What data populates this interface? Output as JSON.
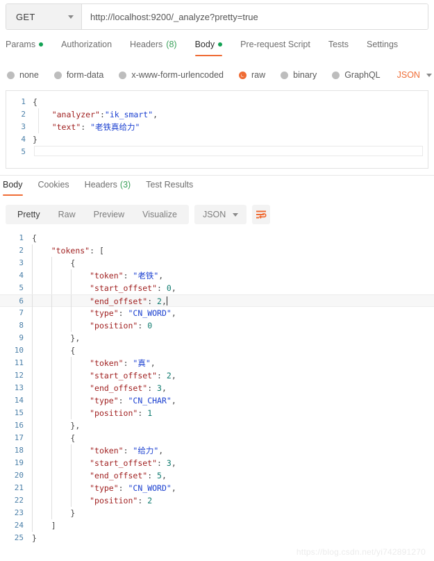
{
  "request_bar": {
    "method": "GET",
    "url": "http://localhost:9200/_analyze?pretty=true"
  },
  "request_tabs": [
    {
      "label": "Params",
      "indicator": "dot",
      "active": false
    },
    {
      "label": "Authorization",
      "indicator": "",
      "active": false
    },
    {
      "label": "Headers",
      "count": "(8)",
      "indicator": "count",
      "active": false
    },
    {
      "label": "Body",
      "indicator": "dot",
      "active": true
    },
    {
      "label": "Pre-request Script",
      "indicator": "",
      "active": false
    },
    {
      "label": "Tests",
      "indicator": "",
      "active": false
    },
    {
      "label": "Settings",
      "indicator": "",
      "active": false
    }
  ],
  "body_types": [
    {
      "label": "none",
      "selected": false
    },
    {
      "label": "form-data",
      "selected": false
    },
    {
      "label": "x-www-form-urlencoded",
      "selected": false
    },
    {
      "label": "raw",
      "selected": true
    },
    {
      "label": "binary",
      "selected": false
    },
    {
      "label": "GraphQL",
      "selected": false
    }
  ],
  "body_format": {
    "label": "JSON"
  },
  "request_body": {
    "lines": [
      {
        "num": "1",
        "segments": [
          {
            "t": "{",
            "c": "p"
          }
        ]
      },
      {
        "num": "2",
        "segments": [
          {
            "t": "    ",
            "c": "p"
          },
          {
            "t": "\"analyzer\"",
            "c": "k"
          },
          {
            "t": ":",
            "c": "p"
          },
          {
            "t": "\"ik_smart\"",
            "c": "s"
          },
          {
            "t": ",",
            "c": "p"
          }
        ]
      },
      {
        "num": "3",
        "segments": [
          {
            "t": "    ",
            "c": "p"
          },
          {
            "t": "\"text\"",
            "c": "k"
          },
          {
            "t": ": ",
            "c": "p"
          },
          {
            "t": "\"老铁真给力\"",
            "c": "s"
          }
        ]
      },
      {
        "num": "4",
        "segments": [
          {
            "t": "}",
            "c": "p"
          }
        ]
      },
      {
        "num": "5",
        "segments": []
      }
    ]
  },
  "response_tabs": [
    {
      "label": "Body",
      "active": true
    },
    {
      "label": "Cookies",
      "active": false
    },
    {
      "label": "Headers",
      "count": "(3)",
      "active": false
    },
    {
      "label": "Test Results",
      "active": false
    }
  ],
  "response_views": [
    {
      "label": "Pretty",
      "active": true
    },
    {
      "label": "Raw",
      "active": false
    },
    {
      "label": "Preview",
      "active": false
    },
    {
      "label": "Visualize",
      "active": false
    }
  ],
  "response_format": {
    "label": "JSON"
  },
  "response_body": {
    "active_line": 6,
    "lines": [
      {
        "num": "1",
        "indent": 0,
        "segments": [
          {
            "t": "{",
            "c": "p"
          }
        ]
      },
      {
        "num": "2",
        "indent": 1,
        "segments": [
          {
            "t": "    ",
            "c": "p"
          },
          {
            "t": "\"tokens\"",
            "c": "k"
          },
          {
            "t": ": [",
            "c": "p"
          }
        ]
      },
      {
        "num": "3",
        "indent": 2,
        "segments": [
          {
            "t": "        ",
            "c": "p"
          },
          {
            "t": "{",
            "c": "p"
          }
        ]
      },
      {
        "num": "4",
        "indent": 3,
        "segments": [
          {
            "t": "            ",
            "c": "p"
          },
          {
            "t": "\"token\"",
            "c": "k"
          },
          {
            "t": ": ",
            "c": "p"
          },
          {
            "t": "\"老铁\"",
            "c": "s"
          },
          {
            "t": ",",
            "c": "p"
          }
        ]
      },
      {
        "num": "5",
        "indent": 3,
        "segments": [
          {
            "t": "            ",
            "c": "p"
          },
          {
            "t": "\"start_offset\"",
            "c": "k"
          },
          {
            "t": ": ",
            "c": "p"
          },
          {
            "t": "0",
            "c": "n"
          },
          {
            "t": ",",
            "c": "p"
          }
        ]
      },
      {
        "num": "6",
        "indent": 3,
        "segments": [
          {
            "t": "            ",
            "c": "p"
          },
          {
            "t": "\"end_offset\"",
            "c": "k"
          },
          {
            "t": ": ",
            "c": "p"
          },
          {
            "t": "2",
            "c": "n"
          },
          {
            "t": ",",
            "c": "p"
          }
        ]
      },
      {
        "num": "7",
        "indent": 3,
        "segments": [
          {
            "t": "            ",
            "c": "p"
          },
          {
            "t": "\"type\"",
            "c": "k"
          },
          {
            "t": ": ",
            "c": "p"
          },
          {
            "t": "\"CN_WORD\"",
            "c": "s"
          },
          {
            "t": ",",
            "c": "p"
          }
        ]
      },
      {
        "num": "8",
        "indent": 3,
        "segments": [
          {
            "t": "            ",
            "c": "p"
          },
          {
            "t": "\"position\"",
            "c": "k"
          },
          {
            "t": ": ",
            "c": "p"
          },
          {
            "t": "0",
            "c": "n"
          }
        ]
      },
      {
        "num": "9",
        "indent": 2,
        "segments": [
          {
            "t": "        ",
            "c": "p"
          },
          {
            "t": "},",
            "c": "p"
          }
        ]
      },
      {
        "num": "10",
        "indent": 2,
        "segments": [
          {
            "t": "        ",
            "c": "p"
          },
          {
            "t": "{",
            "c": "p"
          }
        ]
      },
      {
        "num": "11",
        "indent": 3,
        "segments": [
          {
            "t": "            ",
            "c": "p"
          },
          {
            "t": "\"token\"",
            "c": "k"
          },
          {
            "t": ": ",
            "c": "p"
          },
          {
            "t": "\"真\"",
            "c": "s"
          },
          {
            "t": ",",
            "c": "p"
          }
        ]
      },
      {
        "num": "12",
        "indent": 3,
        "segments": [
          {
            "t": "            ",
            "c": "p"
          },
          {
            "t": "\"start_offset\"",
            "c": "k"
          },
          {
            "t": ": ",
            "c": "p"
          },
          {
            "t": "2",
            "c": "n"
          },
          {
            "t": ",",
            "c": "p"
          }
        ]
      },
      {
        "num": "13",
        "indent": 3,
        "segments": [
          {
            "t": "            ",
            "c": "p"
          },
          {
            "t": "\"end_offset\"",
            "c": "k"
          },
          {
            "t": ": ",
            "c": "p"
          },
          {
            "t": "3",
            "c": "n"
          },
          {
            "t": ",",
            "c": "p"
          }
        ]
      },
      {
        "num": "14",
        "indent": 3,
        "segments": [
          {
            "t": "            ",
            "c": "p"
          },
          {
            "t": "\"type\"",
            "c": "k"
          },
          {
            "t": ": ",
            "c": "p"
          },
          {
            "t": "\"CN_CHAR\"",
            "c": "s"
          },
          {
            "t": ",",
            "c": "p"
          }
        ]
      },
      {
        "num": "15",
        "indent": 3,
        "segments": [
          {
            "t": "            ",
            "c": "p"
          },
          {
            "t": "\"position\"",
            "c": "k"
          },
          {
            "t": ": ",
            "c": "p"
          },
          {
            "t": "1",
            "c": "n"
          }
        ]
      },
      {
        "num": "16",
        "indent": 2,
        "segments": [
          {
            "t": "        ",
            "c": "p"
          },
          {
            "t": "},",
            "c": "p"
          }
        ]
      },
      {
        "num": "17",
        "indent": 2,
        "segments": [
          {
            "t": "        ",
            "c": "p"
          },
          {
            "t": "{",
            "c": "p"
          }
        ]
      },
      {
        "num": "18",
        "indent": 3,
        "segments": [
          {
            "t": "            ",
            "c": "p"
          },
          {
            "t": "\"token\"",
            "c": "k"
          },
          {
            "t": ": ",
            "c": "p"
          },
          {
            "t": "\"给力\"",
            "c": "s"
          },
          {
            "t": ",",
            "c": "p"
          }
        ]
      },
      {
        "num": "19",
        "indent": 3,
        "segments": [
          {
            "t": "            ",
            "c": "p"
          },
          {
            "t": "\"start_offset\"",
            "c": "k"
          },
          {
            "t": ": ",
            "c": "p"
          },
          {
            "t": "3",
            "c": "n"
          },
          {
            "t": ",",
            "c": "p"
          }
        ]
      },
      {
        "num": "20",
        "indent": 3,
        "segments": [
          {
            "t": "            ",
            "c": "p"
          },
          {
            "t": "\"end_offset\"",
            "c": "k"
          },
          {
            "t": ": ",
            "c": "p"
          },
          {
            "t": "5",
            "c": "n"
          },
          {
            "t": ",",
            "c": "p"
          }
        ]
      },
      {
        "num": "21",
        "indent": 3,
        "segments": [
          {
            "t": "            ",
            "c": "p"
          },
          {
            "t": "\"type\"",
            "c": "k"
          },
          {
            "t": ": ",
            "c": "p"
          },
          {
            "t": "\"CN_WORD\"",
            "c": "s"
          },
          {
            "t": ",",
            "c": "p"
          }
        ]
      },
      {
        "num": "22",
        "indent": 3,
        "segments": [
          {
            "t": "            ",
            "c": "p"
          },
          {
            "t": "\"position\"",
            "c": "k"
          },
          {
            "t": ": ",
            "c": "p"
          },
          {
            "t": "2",
            "c": "n"
          }
        ]
      },
      {
        "num": "23",
        "indent": 2,
        "segments": [
          {
            "t": "        ",
            "c": "p"
          },
          {
            "t": "}",
            "c": "p"
          }
        ]
      },
      {
        "num": "24",
        "indent": 1,
        "segments": [
          {
            "t": "    ",
            "c": "p"
          },
          {
            "t": "]",
            "c": "p"
          }
        ]
      },
      {
        "num": "25",
        "indent": 0,
        "segments": [
          {
            "t": "}",
            "c": "p"
          }
        ]
      }
    ]
  },
  "watermark": {
    "text": "https://blog.csdn.net/yi742891270"
  },
  "colors": {
    "accent_orange": "#ef6c35",
    "indicator_green": "#13a254",
    "json_key": "#a02020",
    "json_string": "#1a3fd0",
    "json_number": "#0d7a6e",
    "line_number": "#4a7fa8"
  }
}
